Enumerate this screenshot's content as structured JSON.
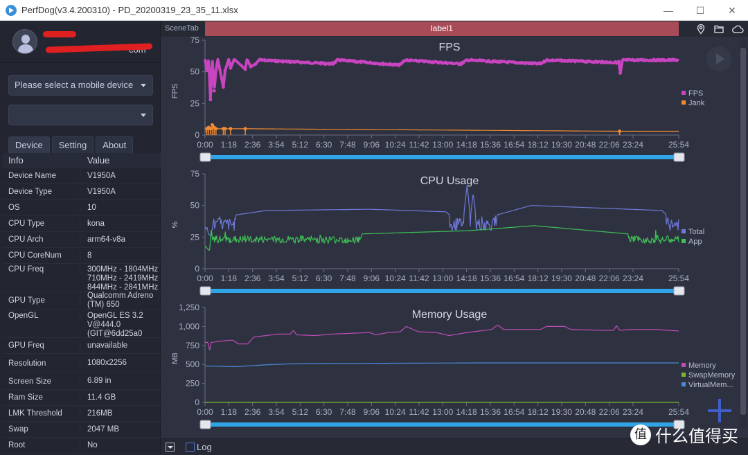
{
  "window": {
    "title": "PerfDog(v3.4.200310) - PD_20200319_23_35_11.xlsx",
    "controls": {
      "minimize": "—",
      "maximize": "☐",
      "close": "✕"
    }
  },
  "sidebar": {
    "user": {
      "email_suffix": "com"
    },
    "device_select": {
      "placeholder": "Please select a mobile device"
    },
    "app_select": {
      "value": ""
    },
    "tabs": [
      {
        "label": "Device",
        "active": true
      },
      {
        "label": "Setting",
        "active": false
      },
      {
        "label": "About",
        "active": false
      }
    ],
    "table": {
      "headers": [
        "Info",
        "Value"
      ],
      "rows": [
        {
          "key": "Device Name",
          "value": "V1950A"
        },
        {
          "key": "Device Type",
          "value": "V1950A"
        },
        {
          "key": "OS",
          "value": "10"
        },
        {
          "key": "CPU Type",
          "value": "kona"
        },
        {
          "key": "CPU Arch",
          "value": "arm64-v8a"
        },
        {
          "key": "CPU CoreNum",
          "value": "8"
        },
        {
          "key": "CPU Freq",
          "value": "300MHz - 1804MHz 710MHz - 2419MHz 844MHz - 2841MHz"
        },
        {
          "key": "GPU Type",
          "value": "Qualcomm Adreno (TM) 650"
        },
        {
          "key": "OpenGL",
          "value": "OpenGL ES 3.2 V@444.0 (GIT@6dd25a0"
        },
        {
          "key": "GPU Freq",
          "value": "unavailable"
        },
        {
          "key": "Resolution",
          "value": "1080x2256"
        },
        {
          "key": "Screen Size",
          "value": "6.89 in"
        },
        {
          "key": "Ram Size",
          "value": "11.4 GB"
        },
        {
          "key": "LMK Threshold",
          "value": "216MB"
        },
        {
          "key": "Swap",
          "value": "2047 MB"
        },
        {
          "key": "Root",
          "value": "No"
        }
      ]
    }
  },
  "main": {
    "scene_tab": "SceneTab",
    "label": "label1",
    "icons": [
      "location-icon",
      "folder-icon",
      "cloud-icon"
    ],
    "log_label": "Log",
    "watermark": {
      "logo": "值",
      "text": "什么值得买"
    }
  },
  "colors": {
    "fps": "#c844c0",
    "jank": "#f08a30",
    "total": "#6f79d9",
    "app": "#3fbf55",
    "memory": "#c04cb8",
    "swap": "#7ab830",
    "virtual": "#4a8ad8",
    "slider": "#2fa4e7",
    "label_bar": "#a84b58"
  },
  "chart_data": [
    {
      "type": "line",
      "title": "FPS",
      "ylabel": "FPS",
      "xlabel": "",
      "ylim": [
        0,
        75
      ],
      "yticks": [
        "0",
        "25",
        "50",
        "75"
      ],
      "xticks": [
        "0:00",
        "1:18",
        "2:36",
        "3:54",
        "5:12",
        "6:30",
        "7:48",
        "9:06",
        "10:24",
        "11:42",
        "13:00",
        "14:18",
        "15:36",
        "16:54",
        "18:12",
        "19:30",
        "20:48",
        "22:06",
        "23:24",
        "25:54"
      ],
      "xrange_seconds": [
        0,
        1554
      ],
      "series": [
        {
          "name": "FPS",
          "color": "#c844c0",
          "baseline": 60,
          "points": [
            [
              0,
              60
            ],
            [
              6,
              51
            ],
            [
              12,
              60
            ],
            [
              18,
              28
            ],
            [
              24,
              60
            ],
            [
              30,
              35
            ],
            [
              36,
              51
            ],
            [
              42,
              60
            ],
            [
              60,
              38
            ],
            [
              66,
              51
            ],
            [
              78,
              60
            ],
            [
              84,
              53
            ],
            [
              96,
              60
            ],
            [
              132,
              52
            ],
            [
              138,
              60
            ],
            [
              150,
              54
            ],
            [
              165,
              56
            ],
            [
              180,
              60
            ],
            [
              420,
              57
            ],
            [
              435,
              60
            ],
            [
              640,
              56
            ],
            [
              655,
              60
            ],
            [
              840,
              57
            ],
            [
              860,
              60
            ],
            [
              1100,
              57
            ],
            [
              1120,
              60
            ],
            [
              1358,
              58
            ],
            [
              1362,
              49
            ],
            [
              1370,
              60
            ],
            [
              1554,
              60
            ]
          ]
        },
        {
          "name": "Jank",
          "color": "#f08a30",
          "baseline": 0,
          "points": [
            [
              6,
              5
            ],
            [
              12,
              6
            ],
            [
              18,
              5
            ],
            [
              24,
              8
            ],
            [
              30,
              6
            ],
            [
              36,
              5
            ],
            [
              60,
              5
            ],
            [
              66,
              5
            ],
            [
              84,
              5
            ],
            [
              132,
              5
            ],
            [
              1360,
              3
            ]
          ]
        }
      ],
      "legend": [
        "FPS",
        "Jank"
      ],
      "legend_position": "right"
    },
    {
      "type": "line",
      "title": "CPU Usage",
      "ylabel": "%",
      "xlabel": "",
      "ylim": [
        0,
        75
      ],
      "yticks": [
        "0",
        "25",
        "50",
        "75"
      ],
      "xticks": [
        "0:00",
        "1:18",
        "2:36",
        "3:54",
        "5:12",
        "6:30",
        "7:48",
        "9:06",
        "10:24",
        "11:42",
        "13:00",
        "14:18",
        "15:36",
        "16:54",
        "18:12",
        "19:30",
        "20:48",
        "22:06",
        "23:24",
        "25:54"
      ],
      "xrange_seconds": [
        0,
        1554
      ],
      "series": [
        {
          "name": "Total",
          "color": "#6f79d9",
          "mean": 35,
          "noise": 5,
          "points": [
            [
              0,
              29
            ],
            [
              20,
              26
            ],
            [
              30,
              40
            ],
            [
              200,
              46
            ],
            [
              540,
              47
            ],
            [
              790,
              45
            ],
            [
              845,
              34
            ],
            [
              860,
              67
            ],
            [
              870,
              40
            ],
            [
              880,
              60
            ],
            [
              890,
              38
            ],
            [
              1070,
              50
            ],
            [
              1500,
              46
            ],
            [
              1554,
              32
            ]
          ]
        },
        {
          "name": "App",
          "color": "#3fbf55",
          "mean": 23,
          "noise": 3,
          "points": [
            [
              0,
              18
            ],
            [
              15,
              14
            ],
            [
              20,
              30
            ],
            [
              30,
              24
            ],
            [
              860,
              30
            ],
            [
              1080,
              34
            ],
            [
              1554,
              24
            ]
          ]
        }
      ],
      "legend": [
        "Total",
        "App"
      ],
      "legend_position": "right"
    },
    {
      "type": "line",
      "title": "Memory Usage",
      "ylabel": "MB",
      "xlabel": "",
      "ylim": [
        0,
        1250
      ],
      "yticks": [
        "0",
        "250",
        "500",
        "750",
        "1,000",
        "1,250"
      ],
      "xticks": [
        "0:00",
        "1:18",
        "2:36",
        "3:54",
        "5:12",
        "6:30",
        "7:48",
        "9:06",
        "10:24",
        "11:42",
        "13:00",
        "14:18",
        "15:36",
        "16:54",
        "18:12",
        "19:30",
        "20:48",
        "22:06",
        "23:24",
        "25:54"
      ],
      "xrange_seconds": [
        0,
        1554
      ],
      "series": [
        {
          "name": "Memory",
          "color": "#c04cb8",
          "points": [
            [
              0,
              790
            ],
            [
              10,
              790
            ],
            [
              15,
              680
            ],
            [
              20,
              790
            ],
            [
              60,
              810
            ],
            [
              90,
              820
            ],
            [
              110,
              770
            ],
            [
              140,
              770
            ],
            [
              160,
              860
            ],
            [
              200,
              880
            ],
            [
              240,
              900
            ],
            [
              280,
              900
            ],
            [
              290,
              950
            ],
            [
              300,
              890
            ],
            [
              360,
              880
            ],
            [
              420,
              900
            ],
            [
              480,
              910
            ],
            [
              540,
              920
            ],
            [
              560,
              890
            ],
            [
              600,
              920
            ],
            [
              640,
              930
            ],
            [
              660,
              1000
            ],
            [
              700,
              930
            ],
            [
              760,
              920
            ],
            [
              800,
              880
            ],
            [
              860,
              920
            ],
            [
              900,
              940
            ],
            [
              940,
              960
            ],
            [
              960,
              1020
            ],
            [
              980,
              960
            ],
            [
              1000,
              960
            ],
            [
              1100,
              960
            ],
            [
              1120,
              1000
            ],
            [
              1180,
              1000
            ],
            [
              1200,
              960
            ],
            [
              1300,
              950
            ],
            [
              1340,
              950
            ],
            [
              1350,
              1010
            ],
            [
              1360,
              950
            ],
            [
              1400,
              960
            ],
            [
              1480,
              960
            ],
            [
              1554,
              940
            ]
          ]
        },
        {
          "name": "SwapMemory",
          "color": "#7ab830",
          "points": [
            [
              0,
              0
            ],
            [
              1554,
              0
            ]
          ]
        },
        {
          "name": "VirtualMemory",
          "color": "#4a8ad8",
          "points": [
            [
              0,
              480
            ],
            [
              100,
              470
            ],
            [
              200,
              495
            ],
            [
              300,
              510
            ],
            [
              600,
              515
            ],
            [
              900,
              520
            ],
            [
              1554,
              520
            ]
          ]
        }
      ],
      "legend": [
        "Memory",
        "SwapMemory",
        "VirtualMem..."
      ],
      "legend_position": "right"
    }
  ]
}
